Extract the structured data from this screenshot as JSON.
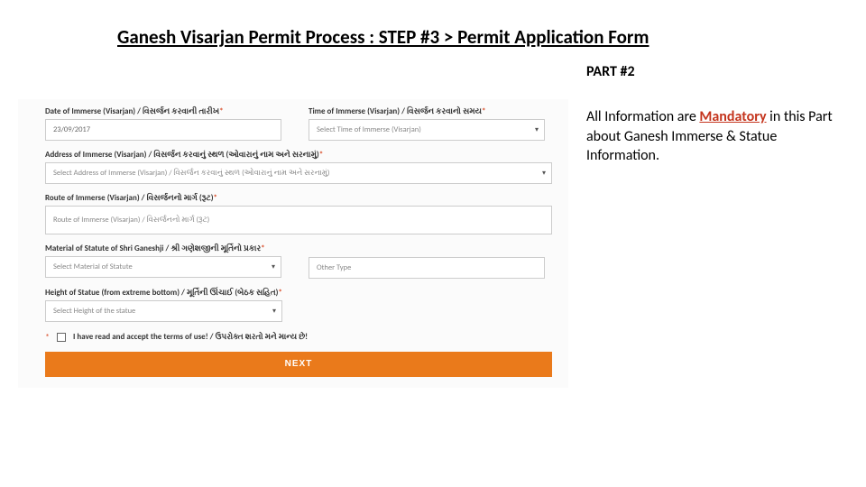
{
  "title": "Ganesh Visarjan Permit Process : STEP #3 > Permit Application Form",
  "sidebar": {
    "part_label": "PART #2",
    "info_pre": "All Information are ",
    "info_mandatory": "Mandatory",
    "info_post": " in this Part about Ganesh Immerse & Statue Information."
  },
  "form": {
    "date": {
      "label": "Date of Immerse (Visarjan) / વિસર્જન કરવાની તારીખ",
      "value": "23/09/2017"
    },
    "time": {
      "label": "Time of Immerse (Visarjan) / વિસર્જન કરવાનો સમય",
      "placeholder": "Select Time of Immerse (Visarjan)"
    },
    "address": {
      "label": "Address of Immerse (Visarjan) / વિસર્જન કરવાનું સ્થળ (ઓવારાનું નામ અને સરનામું)",
      "placeholder": "Select Address of Immerse (Visarjan) / વિસર્જન કરવાનું સ્થળ (ઓવારાનું નામ અને સરનામું)"
    },
    "route": {
      "label": "Route of Immerse (Visarjan) / વિસર્જનનો માર્ગ (રૂટ)",
      "placeholder": "Route of Immerse (Visarjan) / વિસર્જનનો માર્ગ (રૂટ)"
    },
    "material": {
      "label": "Material of Statute of Shri Ganeshji / શ્રી ગણેશજીની મૂર્તિનો પ્રકાર",
      "placeholder": "Select Material of Statute"
    },
    "other_type": {
      "placeholder": "Other Type"
    },
    "height": {
      "label": "Height of Statue (from extreme bottom) / મૂર્તિની ઊંચાઈ (બેઠક સહિત)",
      "placeholder": "Select Height of the statue"
    },
    "terms": "I have read and accept the terms of use! / ઉપરોક્ત શરતો મને માન્ય છે!",
    "next": "NEXT"
  }
}
